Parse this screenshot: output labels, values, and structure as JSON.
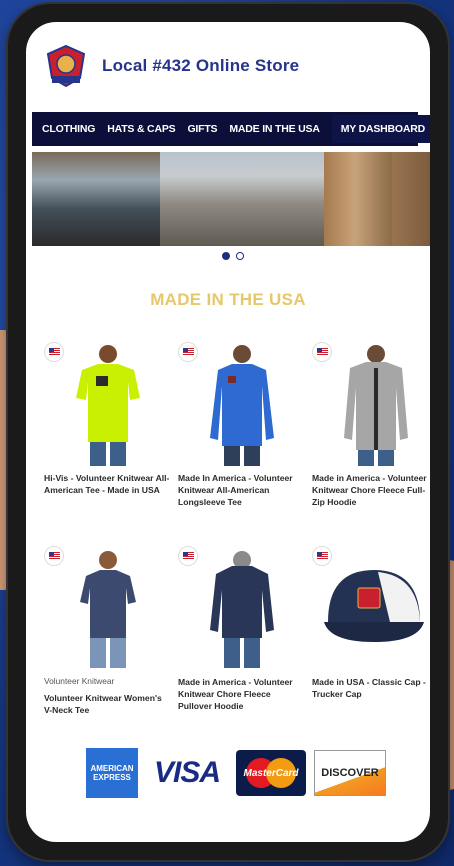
{
  "store": {
    "title": "Local #432 Online Store"
  },
  "nav": {
    "items": [
      "CLOTHING",
      "HATS & CAPS",
      "GIFTS",
      "MADE IN THE USA",
      "MY DASHBOARD"
    ]
  },
  "carousel": {
    "slides": 2,
    "active": 1
  },
  "section": {
    "title": "MADE IN THE USA"
  },
  "products": [
    {
      "brand": "",
      "name": "Hi-Vis - Volunteer Knitwear All-American Tee - Made in USA",
      "color": "#c8f000"
    },
    {
      "brand": "",
      "name": "Made In America - Volunteer Knitwear All-American Longsleeve Tee",
      "color": "#2e6ad1"
    },
    {
      "brand": "",
      "name": "Made in America - Volunteer Knitwear Chore Fleece Full-Zip Hoodie",
      "color": "#a6a6a6"
    },
    {
      "brand": "Volunteer Knitwear",
      "name": "Volunteer Knitwear Women's V-Neck Tee",
      "color": "#3b4a6e"
    },
    {
      "brand": "",
      "name": "Made in America - Volunteer Knitwear Chore Fleece Pullover Hoodie",
      "color": "#2a3658"
    },
    {
      "brand": "",
      "name": "Made in USA - Classic Cap - Trucker Cap",
      "color": "#233252"
    }
  ],
  "payments": {
    "amex": "AMERICAN EXPRESS",
    "visa": "VISA",
    "mastercard": "MasterCard",
    "discover": "DISCOVER"
  },
  "colors": {
    "brand": "#27348b",
    "nav_bg": "#0b0f3a",
    "section_title": "#e6c86a"
  }
}
